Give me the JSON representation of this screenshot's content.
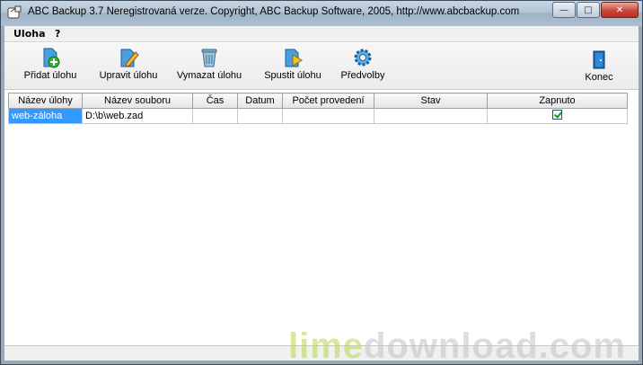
{
  "window": {
    "title": "ABC Backup 3.7  Neregistrovaná verze.  Copyright,  ABC Backup Software, 2005,  http://www.abcbackup.com",
    "buttons": {
      "minimize": "—",
      "maximize": "□",
      "close": "✕"
    }
  },
  "menu": {
    "items": [
      "Uloha",
      "?"
    ]
  },
  "toolbar": {
    "buttons": [
      {
        "label": "Přidat úlohu",
        "icon": "add-task-icon"
      },
      {
        "label": "Upravit úlohu",
        "icon": "edit-task-icon"
      },
      {
        "label": "Vymazat úlohu",
        "icon": "delete-task-icon"
      },
      {
        "label": "Spustit úlohu",
        "icon": "run-task-icon"
      },
      {
        "label": "Předvolby",
        "icon": "settings-gear-icon"
      },
      {
        "label": "Konec",
        "icon": "exit-door-icon"
      }
    ]
  },
  "grid": {
    "columns": [
      "Název úlohy",
      "Název souboru",
      "Čas",
      "Datum",
      "Počet provedení",
      "Stav",
      "Zapnuto"
    ],
    "rows": [
      {
        "name": "web-záloha",
        "file": "D:\\b\\web.zad",
        "time": "",
        "date": "",
        "runs": "",
        "state": "",
        "enabled": true
      }
    ]
  },
  "watermark": {
    "part1": "lime",
    "part2": "download.com"
  },
  "colors": {
    "selection": "#3399ff",
    "check": "#1a9c1a",
    "watermark_green": "#b5d84c"
  }
}
